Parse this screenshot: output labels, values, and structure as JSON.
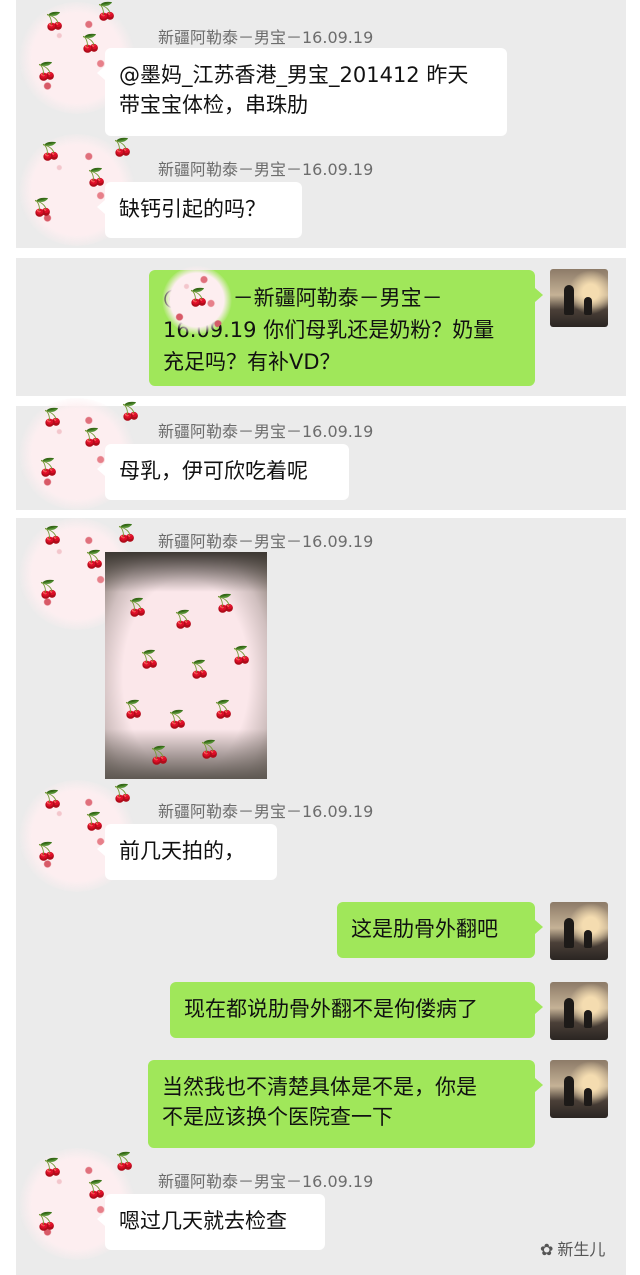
{
  "sender": "新疆阿勒泰－男宝－16.09.19",
  "messages": [
    {
      "text_line1": "@墨妈_江苏香港_男宝_201412 昨天",
      "text_line2": "带宝宝体检，串珠肋"
    },
    {
      "text": "缺钙引起的吗？"
    },
    {
      "quote_line1": "@　　 －新疆阿勒泰－男宝－",
      "quote_line2": "16.09.19 你们母乳还是奶粉？奶量",
      "quote_line3": "充足吗？有补VD？"
    },
    {
      "text": "母乳，伊可欣吃着呢"
    },
    {
      "text": "前几天拍的，"
    },
    {
      "text": "这是肋骨外翻吧"
    },
    {
      "text": "现在都说肋骨外翻不是佝偻病了"
    },
    {
      "text_line1": "当然我也不清楚具体是不是，你是",
      "text_line2": "不是应该换个医院查一下"
    },
    {
      "text": "嗯过几天就去检查"
    }
  ],
  "watermark": {
    "icon": "wechat-icon",
    "label": "新生儿"
  },
  "colors": {
    "panel": "#ebebeb",
    "self_bubble": "#a0e75a",
    "other_bubble": "#ffffff"
  }
}
